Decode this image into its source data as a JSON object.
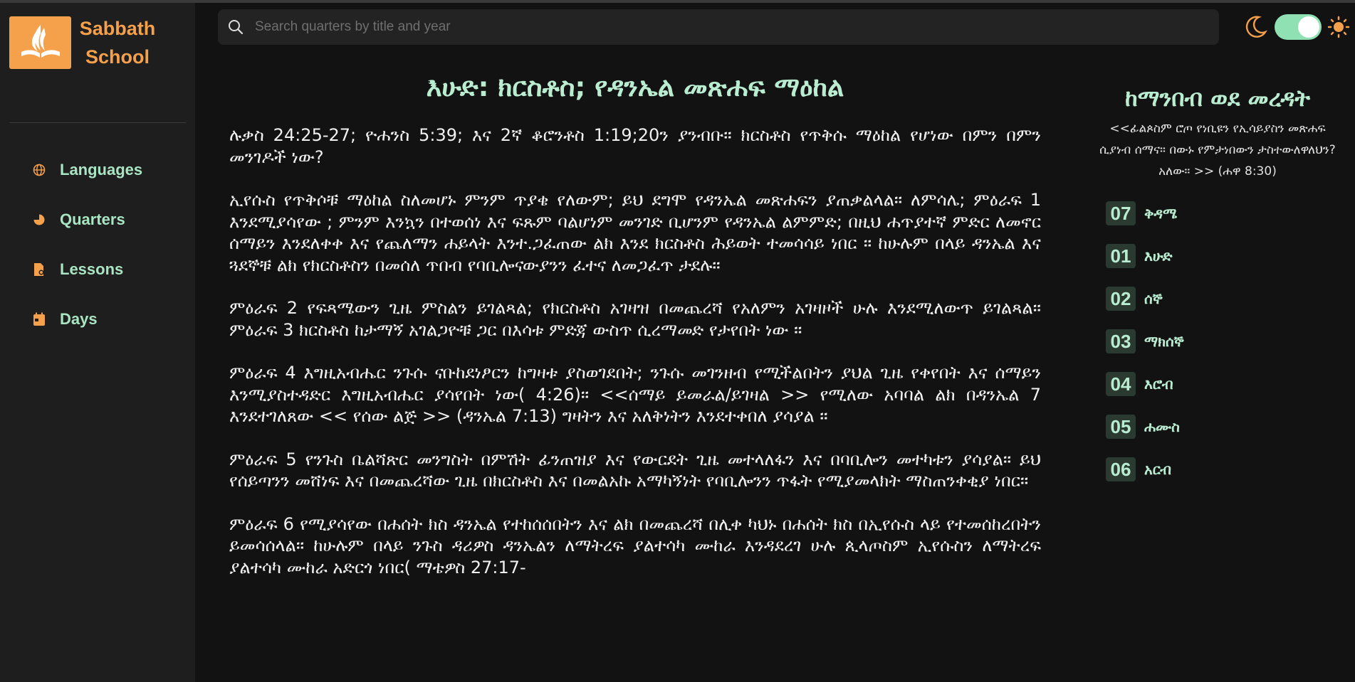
{
  "brand": {
    "line1": "Sabbath",
    "line2": "School"
  },
  "nav": [
    {
      "label": "Languages",
      "icon": "globe-icon"
    },
    {
      "label": "Quarters",
      "icon": "pie-chart-icon"
    },
    {
      "label": "Lessons",
      "icon": "lesson-file-icon"
    },
    {
      "label": "Days",
      "icon": "calendar-icon"
    }
  ],
  "search": {
    "placeholder": "Search quarters by title and year",
    "value": ""
  },
  "theme": {
    "dark_mode": true,
    "icons": [
      "moon-icon",
      "sun-icon"
    ]
  },
  "article": {
    "title": "እሁድ: ክርስቶስ; የዳንኤል መጽሐፍ ማዕከል",
    "paragraphs": [
      "ሉቃስ 24:25-27; ዮሐንስ 5:39; እና 2ኛ ቆሮንቶስ 1:19;20ን ያንብቡ። ክርስቶስ የጥቅሱ ማዕከል የሆነው በምን በምን መንገዶች ነው?",
      "ኢየሱስ የጥቅሶቹ ማዕከል ስለመሆኑ ምንም ጥያቄ የለውም; ይህ ደግሞ የዳንኤል መጽሐፍን ያጠቃልላል። ለምሳሌ; ምዕራፍ 1 እንደሚያሳየው ; ምንም እንኳን በተወሰነ እና ፍጹም ባልሆነም መንገድ ቢሆንም የዳንኤል ልምምድ; በዚህ ሐጥያተኛ ምድር ለመኖር ሰማይን እንደለቀቀ እና የጨለማን ሐይላት እንተ.ጋፈጠው ልክ እንደ ክርስቶስ ሕይወት ተመሳሳይ ነበር ። ከሁሉም በላይ ዳንኤል እና ጓደኞቹ ልክ የክርስቶስን በመሰለ ጥበብ የባቢሎናውያንን ፈተና ለመጋፈጥ ታደሉ።",
      "ምዕራፍ 2 የፍጻሜውን ጊዜ ምስልን ይገልጻል; የክርስቶስ አገዛዝ በመጨረሻ የአለምን አገዛዞች ሁሉ እንደሚለውጥ ይገልጻል። ምዕራፍ 3 ክርስቶስ ከታማኝ አገልጋዮቹ ጋር በእሳቱ ምድጃ ውስጥ ሲረማመድ የታየበት ነው ።",
      "ምዕራፍ 4 እግዚአብሔር ንጉሱ ናቡከደነፆርን ከግዛቱ ያስወገደበት; ንጉሱ መገንዘብ የሚችልበትን ያህል ጊዜ የቀየበት እና ሰማይን እንሚያስተዳድር እግዚአብሔር ያሳየበት ነው( 4:26)። <<ሰማይ ይመራል/ይገዛል >> የሚለው አባባል ልክ በዳንኤል 7 እንደተገለጸው << የሰው ልጅ >> (ዳንኤል 7:13) ግዛትን እና አለቅነትን እንደተቀበለ ያሳያል ።",
      "ምዕራፍ 5 የንጉስ ቤልሻጽር መንግስት በምሽት ፊንጠዝያ እና የውርደት ጊዜ መተላለፋን እና በባቢሎን መተካቱን ያሳያል። ይህ የሰይጣንን መሸነፍ እና በመጨረሻው ጊዜ በክርስቶስ እና በመልአኩ አማካኝነት የባቢሎንን ጥፋት የሚያመላክት ማስጠንቀቂያ ነበር።",
      "ምዕራፍ 6 የሚያሳየው በሐሰት ክስ ዳንኤል የተከሰሰበትን እና ልክ በመጨረሻ በሊቀ ካህኑ በሐሰት ክስ በኢየሱስ ላይ የተመሰከረበትን ይመሳሰላል። ከሁሉም በላይ ንጉስ ዳሪዎስ ዳንኤልን ለማትረፍ ያልተሳካ ሙከራ እንዳደረገ ሁሉ ጲላጦስም ኢየሱስን ለማትረፍ ያልተሳካ ሙከራ አድርጎ ነበር( ማቴዎስ 27:17-"
    ]
  },
  "right_panel": {
    "title": "ከማንበብ ወደ መረዳት",
    "quote": "<<ፊልጶስም ሮጦ የነቢዩን የኢሳይያስን መጽሐፍ ሲያነብ ሰማና። በውኑ የምታነበውን ታስተውለዋለህን? አለው። >> (ሐዋ 8:30)",
    "days": [
      {
        "num": "07",
        "label": "ቅዳሜ"
      },
      {
        "num": "01",
        "label": "እሁድ"
      },
      {
        "num": "02",
        "label": "ሰኞ"
      },
      {
        "num": "03",
        "label": "ማክሰኞ"
      },
      {
        "num": "04",
        "label": "እሮብ"
      },
      {
        "num": "05",
        "label": "ሐሙስ"
      },
      {
        "num": "06",
        "label": "አርብ"
      }
    ]
  },
  "colors": {
    "accent_orange": "#f5a04a",
    "accent_green": "#b9ecd0",
    "toggle": "#8fe0b2",
    "background": "#121212",
    "sidebar": "#1e1e1e"
  }
}
